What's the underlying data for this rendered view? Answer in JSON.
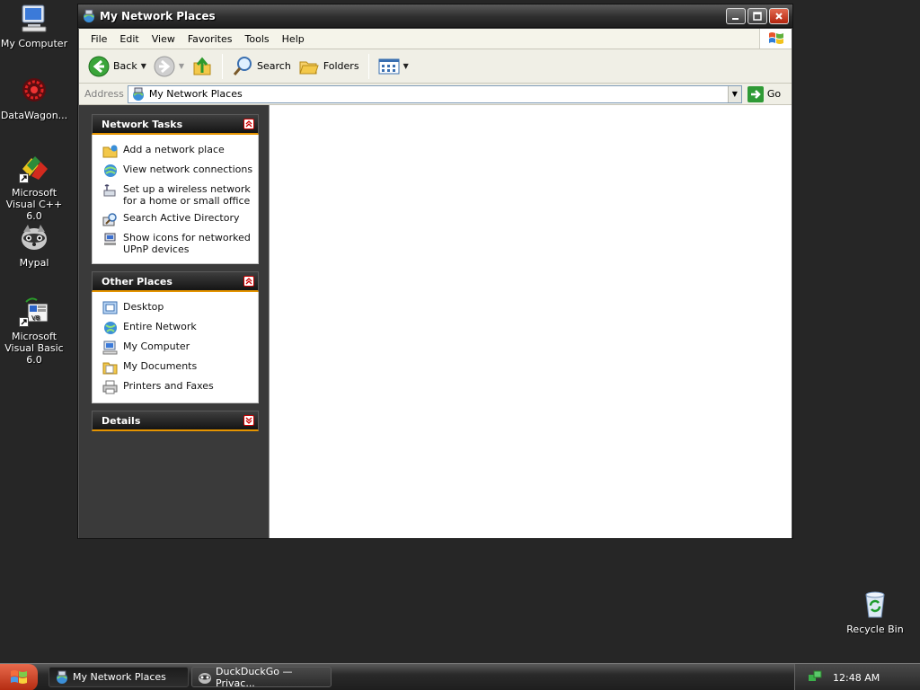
{
  "desktop": {
    "icons": [
      {
        "label": "My Computer",
        "icon": "my-computer-icon"
      },
      {
        "label": "DataWagon...",
        "icon": "datawagon-icon"
      },
      {
        "label": "Microsoft Visual C++ 6.0",
        "icon": "visual-cpp-icon"
      },
      {
        "label": "Mypal",
        "icon": "mypal-icon"
      },
      {
        "label": "Microsoft Visual Basic 6.0",
        "icon": "visual-basic-icon"
      }
    ],
    "recycle_bin": {
      "label": "Recycle Bin",
      "icon": "recycle-bin-icon"
    }
  },
  "window": {
    "title": "My Network Places",
    "menu": [
      "File",
      "Edit",
      "View",
      "Favorites",
      "Tools",
      "Help"
    ],
    "toolbar": {
      "back": "Back",
      "search": "Search",
      "folders": "Folders"
    },
    "address": {
      "label": "Address",
      "value": "My Network Places",
      "go": "Go"
    },
    "network_tasks": {
      "title": "Network Tasks",
      "items": [
        {
          "label": "Add a network place",
          "icon": "add-network-place-icon"
        },
        {
          "label": "View network connections",
          "icon": "network-connections-icon"
        },
        {
          "label": "Set up a wireless network for a home or small office",
          "icon": "wireless-network-icon"
        },
        {
          "label": "Search Active Directory",
          "icon": "search-directory-icon"
        },
        {
          "label": "Show icons for networked UPnP devices",
          "icon": "upnp-devices-icon"
        }
      ]
    },
    "other_places": {
      "title": "Other Places",
      "items": [
        {
          "label": "Desktop",
          "icon": "desktop-icon"
        },
        {
          "label": "Entire Network",
          "icon": "entire-network-icon"
        },
        {
          "label": "My Computer",
          "icon": "my-computer-icon"
        },
        {
          "label": "My Documents",
          "icon": "my-documents-icon"
        },
        {
          "label": "Printers and Faxes",
          "icon": "printers-faxes-icon"
        }
      ]
    },
    "details": {
      "title": "Details"
    }
  },
  "taskbar": {
    "buttons": [
      {
        "label": "My Network Places",
        "active": true
      },
      {
        "label": "DuckDuckGo — Privac..."
      }
    ],
    "clock": "12:48 AM"
  },
  "colors": {
    "accent": "#e59400",
    "desktop_bg": "#262626",
    "close_button": "#c23a1f"
  }
}
